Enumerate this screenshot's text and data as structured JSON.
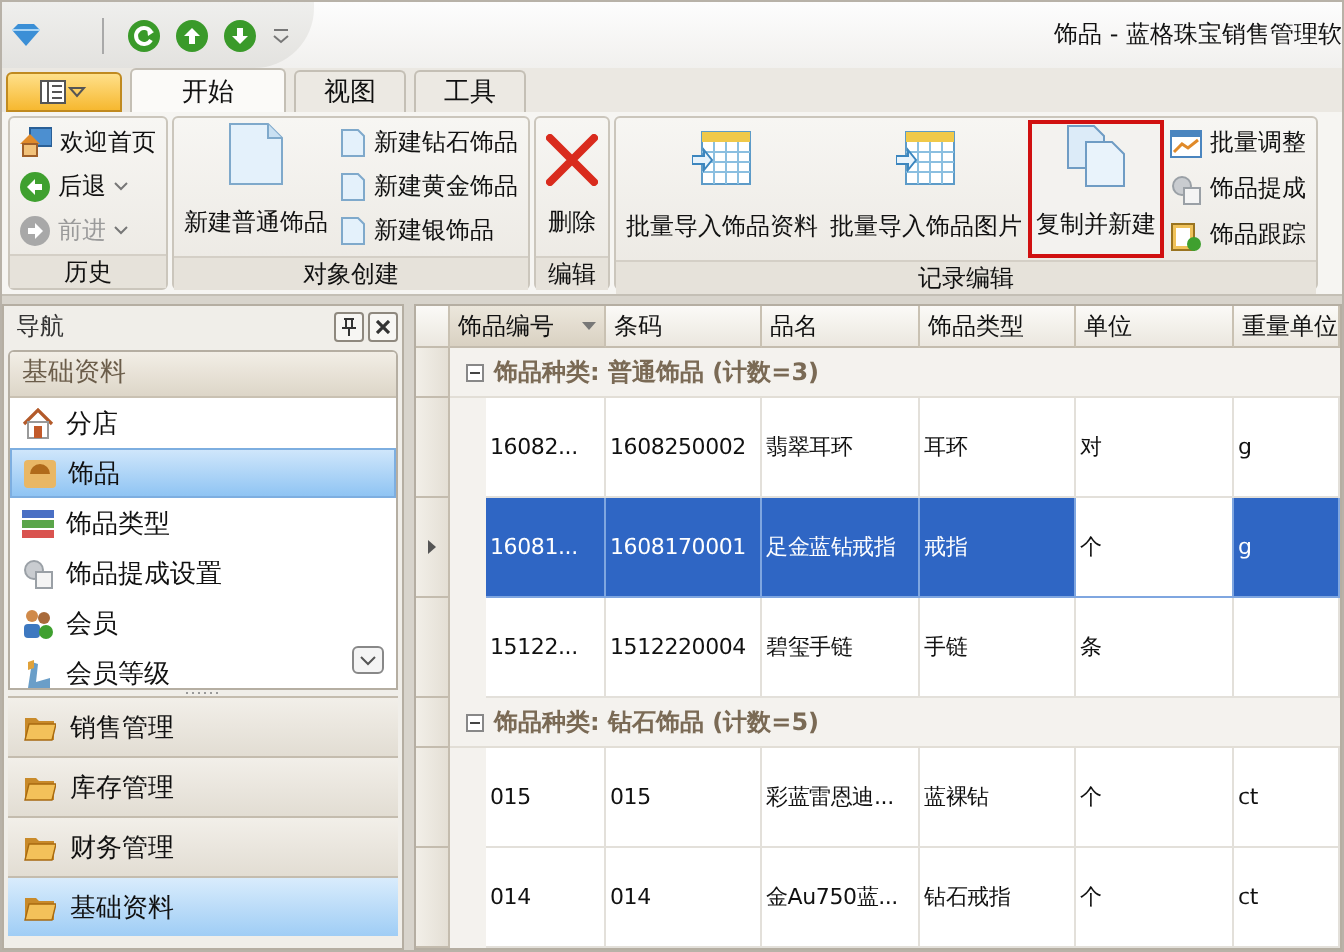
{
  "window": {
    "title": "饰品 - 蓝格珠宝销售管理软"
  },
  "ribbon": {
    "tabs": [
      {
        "label": "开始",
        "selected": true
      },
      {
        "label": "视图",
        "selected": false
      },
      {
        "label": "工具",
        "selected": false
      }
    ],
    "groups": [
      {
        "label": "历史",
        "items": [
          {
            "kind": "small",
            "label": "欢迎首页",
            "disabled": false,
            "dropdown": false,
            "highlighted": false
          },
          {
            "kind": "small",
            "label": "后退",
            "disabled": false,
            "dropdown": true,
            "highlighted": false
          },
          {
            "kind": "small",
            "label": "前进",
            "disabled": true,
            "dropdown": true,
            "highlighted": false
          }
        ]
      },
      {
        "label": "对象创建",
        "items": [
          {
            "kind": "large",
            "label": "新建普通饰品",
            "disabled": false,
            "dropdown": false,
            "highlighted": false
          },
          {
            "kind": "small",
            "label": "新建钻石饰品",
            "disabled": false,
            "dropdown": false,
            "highlighted": false
          },
          {
            "kind": "small",
            "label": "新建黄金饰品",
            "disabled": false,
            "dropdown": false,
            "highlighted": false
          },
          {
            "kind": "small",
            "label": "新建银饰品",
            "disabled": false,
            "dropdown": false,
            "highlighted": false
          }
        ]
      },
      {
        "label": "编辑",
        "items": [
          {
            "kind": "large",
            "label": "删除",
            "disabled": false,
            "dropdown": false,
            "highlighted": false
          }
        ]
      },
      {
        "label": "记录编辑",
        "items": [
          {
            "kind": "large",
            "label": "批量导入饰品资料",
            "disabled": false,
            "dropdown": false,
            "highlighted": false
          },
          {
            "kind": "large",
            "label": "批量导入饰品图片",
            "disabled": false,
            "dropdown": false,
            "highlighted": false
          },
          {
            "kind": "large",
            "label": "复制并新建",
            "disabled": false,
            "dropdown": false,
            "highlighted": true
          },
          {
            "kind": "small",
            "label": "批量调整",
            "disabled": false,
            "dropdown": false,
            "highlighted": false
          },
          {
            "kind": "small",
            "label": "饰品提成",
            "disabled": false,
            "dropdown": false,
            "highlighted": false
          },
          {
            "kind": "small",
            "label": "饰品跟踪",
            "disabled": false,
            "dropdown": false,
            "highlighted": false
          }
        ]
      }
    ]
  },
  "navigation": {
    "title": "导航",
    "group_title": "基础资料",
    "items": [
      {
        "label": "分店",
        "selected": false
      },
      {
        "label": "饰品",
        "selected": true
      },
      {
        "label": "饰品类型",
        "selected": false
      },
      {
        "label": "饰品提成设置",
        "selected": false
      },
      {
        "label": "会员",
        "selected": false
      },
      {
        "label": "会员等级",
        "selected": false
      }
    ],
    "sections": [
      {
        "label": "销售管理",
        "selected": false
      },
      {
        "label": "库存管理",
        "selected": false
      },
      {
        "label": "财务管理",
        "selected": false
      },
      {
        "label": "基础资料",
        "selected": true
      }
    ]
  },
  "grid": {
    "columns": [
      {
        "label": "饰品编号",
        "sorted": true
      },
      {
        "label": "条码",
        "sorted": false
      },
      {
        "label": "品名",
        "sorted": false
      },
      {
        "label": "饰品类型",
        "sorted": false
      },
      {
        "label": "单位",
        "sorted": false
      },
      {
        "label": "重量单位",
        "sorted": false
      }
    ],
    "groups": [
      {
        "label": "饰品种类: 普通饰品 (计数=3)",
        "expanded": true,
        "rows": [
          {
            "selected": false,
            "cells": [
              {
                "text": "16082...",
                "focused": false
              },
              {
                "text": "1608250002",
                "focused": false
              },
              {
                "text": "翡翠耳环",
                "focused": false
              },
              {
                "text": "耳环",
                "focused": false
              },
              {
                "text": "对",
                "focused": false
              },
              {
                "text": "g",
                "focused": false
              }
            ]
          },
          {
            "selected": true,
            "cells": [
              {
                "text": "16081...",
                "focused": false
              },
              {
                "text": "1608170001",
                "focused": false
              },
              {
                "text": "足金蓝钻戒指",
                "focused": false
              },
              {
                "text": "戒指",
                "focused": false
              },
              {
                "text": "个",
                "focused": true
              },
              {
                "text": "g",
                "focused": false
              }
            ]
          },
          {
            "selected": false,
            "cells": [
              {
                "text": "15122...",
                "focused": false
              },
              {
                "text": "1512220004",
                "focused": false
              },
              {
                "text": "碧玺手链",
                "focused": false
              },
              {
                "text": "手链",
                "focused": false
              },
              {
                "text": "条",
                "focused": false
              }
            ]
          }
        ]
      },
      {
        "label": "饰品种类: 钻石饰品 (计数=5)",
        "expanded": true,
        "rows": [
          {
            "selected": false,
            "cells": [
              {
                "text": "015",
                "focused": false
              },
              {
                "text": "015",
                "focused": false
              },
              {
                "text": "彩蓝雷恩迪...",
                "focused": false
              },
              {
                "text": "蓝裸钻",
                "focused": false
              },
              {
                "text": "个",
                "focused": false
              },
              {
                "text": "ct",
                "focused": false
              }
            ]
          },
          {
            "selected": false,
            "cells": [
              {
                "text": "014",
                "focused": false
              },
              {
                "text": "014",
                "focused": false
              },
              {
                "text": "金Au750蓝...",
                "focused": false
              },
              {
                "text": "钻石戒指",
                "focused": false
              },
              {
                "text": "个",
                "focused": false
              },
              {
                "text": "ct",
                "focused": false
              }
            ]
          }
        ]
      }
    ]
  }
}
